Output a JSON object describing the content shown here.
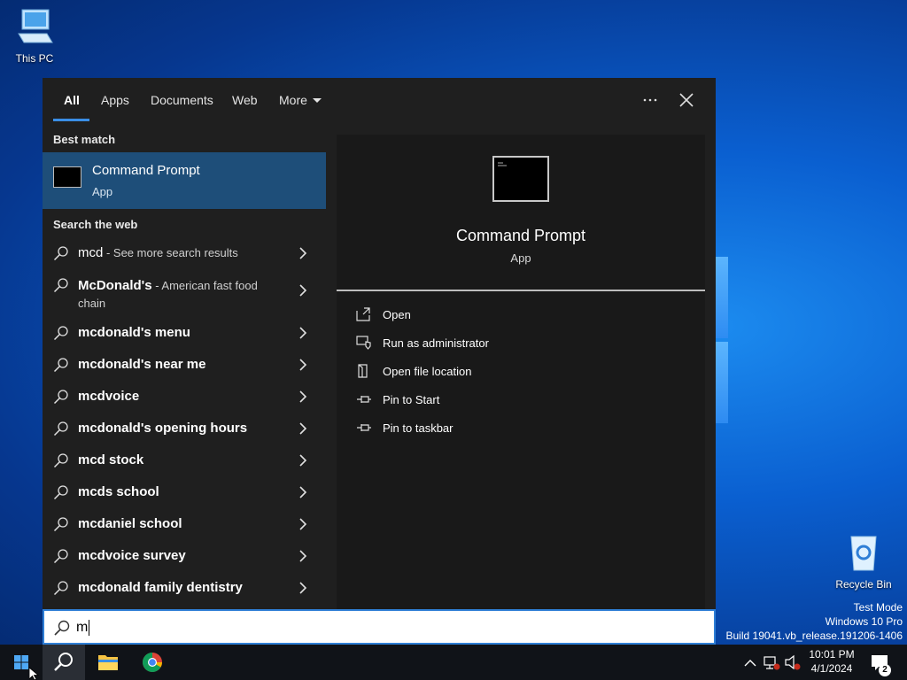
{
  "desktop": {
    "icons": [
      {
        "label": "This PC"
      },
      {
        "label": "Recycle Bin"
      }
    ],
    "watermark": [
      "Test Mode",
      "Windows 10 Pro",
      "Build 19041.vb_release.191206-1406"
    ]
  },
  "search": {
    "tabs": [
      {
        "label": "All",
        "active": true
      },
      {
        "label": "Apps"
      },
      {
        "label": "Documents"
      },
      {
        "label": "Web"
      },
      {
        "label": "More"
      }
    ],
    "more_icon": "ellipsis-icon",
    "close_icon": "close-icon",
    "best_match_heading": "Best match",
    "best_match": {
      "title": "Command Prompt",
      "subtitle": "App"
    },
    "web_heading": "Search the web",
    "web_results": [
      {
        "bold": "mcd",
        "sub": " - See more search results"
      },
      {
        "bold": "McDonald's",
        "sub": " - American fast food chain"
      },
      {
        "bold": "mcdonald's menu",
        "sub": ""
      },
      {
        "bold": "mcdonald's near me",
        "sub": ""
      },
      {
        "bold": "mcdvoice",
        "sub": ""
      },
      {
        "bold": "mcdonald's opening hours",
        "sub": ""
      },
      {
        "bold": "mcd stock",
        "sub": ""
      },
      {
        "bold": "mcds school",
        "sub": ""
      },
      {
        "bold": "mcdaniel school",
        "sub": ""
      },
      {
        "bold": "mcdvoice survey",
        "sub": ""
      },
      {
        "bold": "mcdonald family dentistry",
        "sub": ""
      }
    ],
    "preview": {
      "title": "Command Prompt",
      "subtitle": "App",
      "actions": [
        {
          "label": "Open",
          "icon": "open-icon"
        },
        {
          "label": "Run as administrator",
          "icon": "shield-icon"
        },
        {
          "label": "Open file location",
          "icon": "file-location-icon"
        },
        {
          "label": "Pin to Start",
          "icon": "pin-icon"
        },
        {
          "label": "Pin to taskbar",
          "icon": "pin-icon"
        }
      ]
    },
    "query": "m"
  },
  "taskbar": {
    "clock_time": "10:01 PM",
    "clock_date": "4/1/2024",
    "notification_count": "2",
    "colors": {
      "accent": "#1e4e79",
      "taskbar": "#101318",
      "flyout": "#1f1f1f"
    }
  }
}
